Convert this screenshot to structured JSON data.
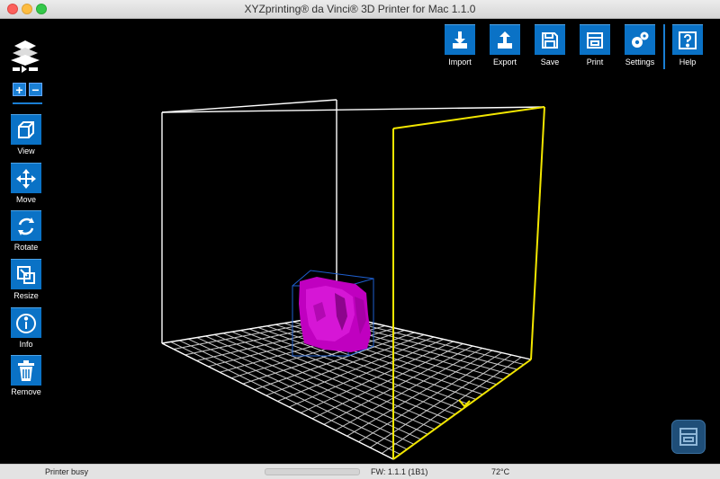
{
  "window": {
    "title": "XYZprinting® da Vinci® 3D Printer for Mac 1.1.0"
  },
  "zoom": {
    "plus": "+",
    "minus": "−"
  },
  "tools": [
    {
      "label": "View",
      "icon": "view-cube-icon"
    },
    {
      "label": "Move",
      "icon": "move-arrows-icon"
    },
    {
      "label": "Rotate",
      "icon": "rotate-icon"
    },
    {
      "label": "Resize",
      "icon": "resize-icon"
    },
    {
      "label": "Info",
      "icon": "info-icon"
    },
    {
      "label": "Remove",
      "icon": "trash-icon"
    }
  ],
  "toolbar": [
    {
      "label": "Import",
      "icon": "import-icon"
    },
    {
      "label": "Export",
      "icon": "export-icon"
    },
    {
      "label": "Save",
      "icon": "save-icon"
    },
    {
      "label": "Print",
      "icon": "print-icon"
    },
    {
      "label": "Settings",
      "icon": "gear-icon"
    },
    {
      "label": "Help",
      "icon": "help-icon"
    }
  ],
  "status": {
    "text": "Printer busy",
    "firmware": "FW: 1.1.1 (1B1)",
    "temperature": "72°C",
    "progress": 0
  },
  "colors": {
    "accent": "#0a72c6",
    "model": "#c800c8",
    "selection_box": "#1e5fcf",
    "build_box": "#ffffff",
    "highlight_edge": "#f2e600"
  }
}
